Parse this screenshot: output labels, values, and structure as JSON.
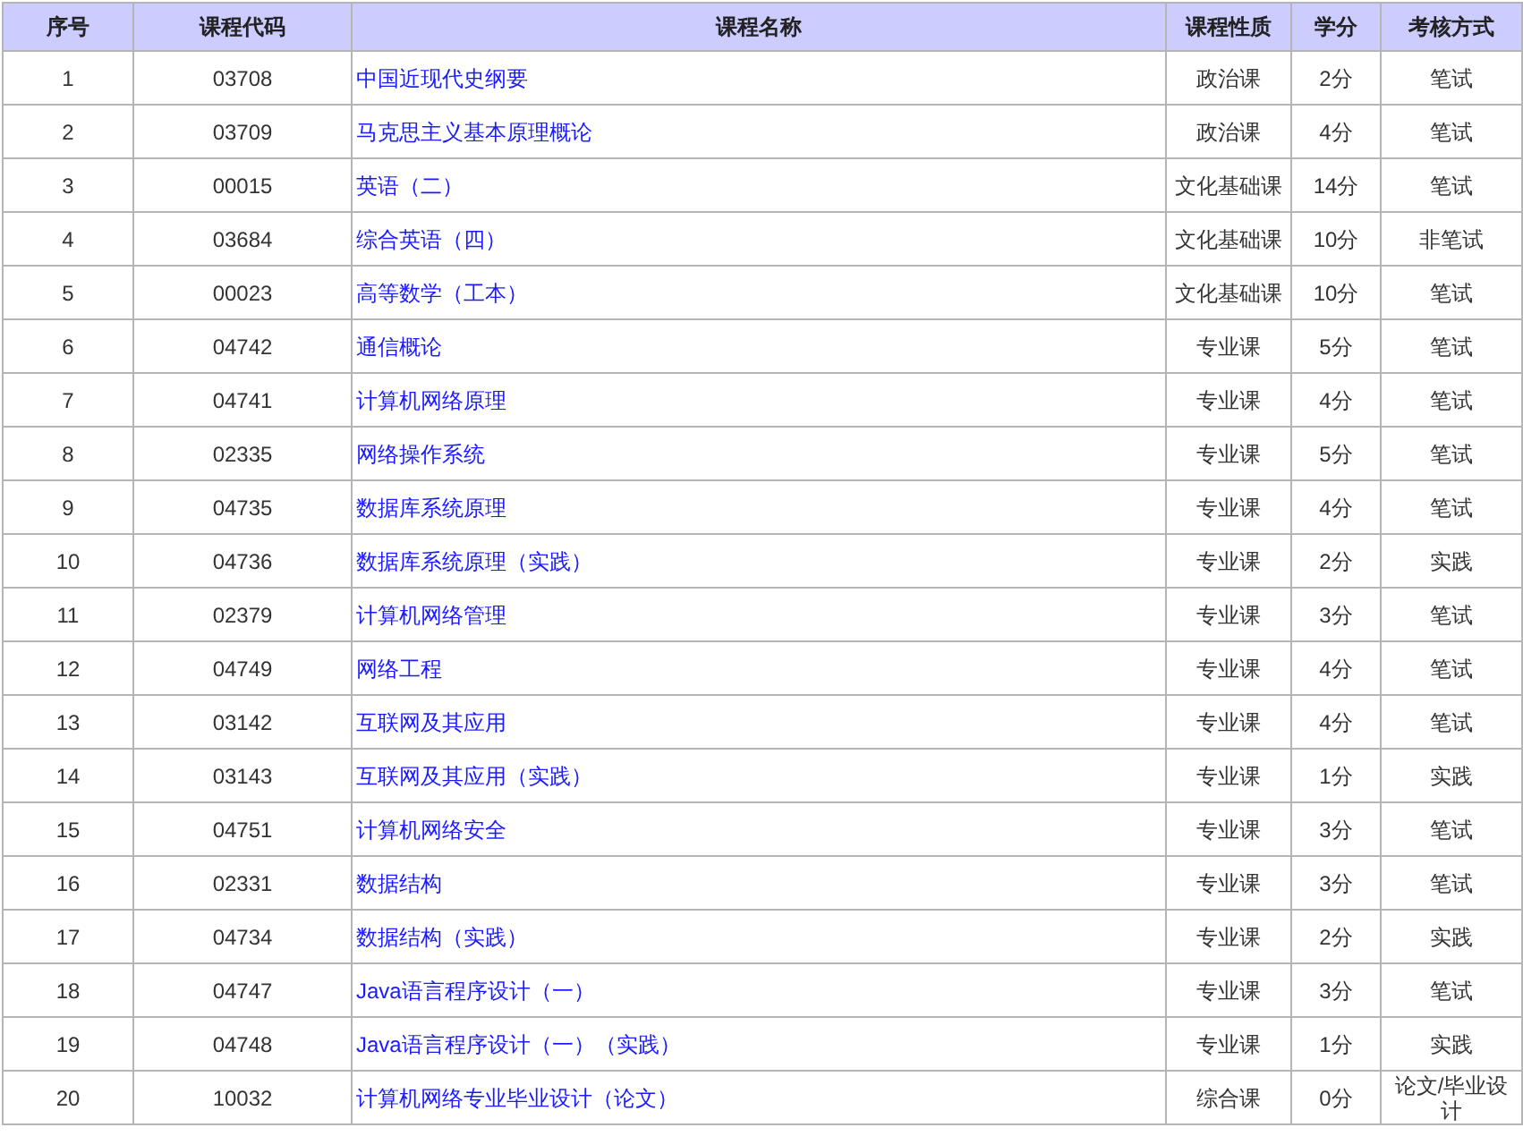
{
  "table": {
    "columns": [
      "序号",
      "课程代码",
      "课程名称",
      "课程性质",
      "学分",
      "考核方式"
    ],
    "rows": [
      {
        "index": "1",
        "code": "03708",
        "name": "中国近现代史纲要",
        "type": "政治课",
        "credits": "2分",
        "exam": "笔试"
      },
      {
        "index": "2",
        "code": "03709",
        "name": "马克思主义基本原理概论",
        "type": "政治课",
        "credits": "4分",
        "exam": "笔试"
      },
      {
        "index": "3",
        "code": "00015",
        "name": "英语（二）",
        "type": "文化基础课",
        "credits": "14分",
        "exam": "笔试"
      },
      {
        "index": "4",
        "code": "03684",
        "name": "综合英语（四）",
        "type": "文化基础课",
        "credits": "10分",
        "exam": "非笔试"
      },
      {
        "index": "5",
        "code": "00023",
        "name": "高等数学（工本）",
        "type": "文化基础课",
        "credits": "10分",
        "exam": "笔试"
      },
      {
        "index": "6",
        "code": "04742",
        "name": "通信概论",
        "type": "专业课",
        "credits": "5分",
        "exam": "笔试"
      },
      {
        "index": "7",
        "code": "04741",
        "name": "计算机网络原理",
        "type": "专业课",
        "credits": "4分",
        "exam": "笔试"
      },
      {
        "index": "8",
        "code": "02335",
        "name": "网络操作系统",
        "type": "专业课",
        "credits": "5分",
        "exam": "笔试"
      },
      {
        "index": "9",
        "code": "04735",
        "name": "数据库系统原理",
        "type": "专业课",
        "credits": "4分",
        "exam": "笔试"
      },
      {
        "index": "10",
        "code": "04736",
        "name": "数据库系统原理（实践）",
        "type": "专业课",
        "credits": "2分",
        "exam": "实践"
      },
      {
        "index": "11",
        "code": "02379",
        "name": "计算机网络管理",
        "type": "专业课",
        "credits": "3分",
        "exam": "笔试"
      },
      {
        "index": "12",
        "code": "04749",
        "name": "网络工程",
        "type": "专业课",
        "credits": "4分",
        "exam": "笔试"
      },
      {
        "index": "13",
        "code": "03142",
        "name": "互联网及其应用",
        "type": "专业课",
        "credits": "4分",
        "exam": "笔试"
      },
      {
        "index": "14",
        "code": "03143",
        "name": "互联网及其应用（实践）",
        "type": "专业课",
        "credits": "1分",
        "exam": "实践"
      },
      {
        "index": "15",
        "code": "04751",
        "name": "计算机网络安全",
        "type": "专业课",
        "credits": "3分",
        "exam": "笔试"
      },
      {
        "index": "16",
        "code": "02331",
        "name": "数据结构",
        "type": "专业课",
        "credits": "3分",
        "exam": "笔试"
      },
      {
        "index": "17",
        "code": "04734",
        "name": "数据结构（实践）",
        "type": "专业课",
        "credits": "2分",
        "exam": "实践"
      },
      {
        "index": "18",
        "code": "04747",
        "name": "Java语言程序设计（一）",
        "type": "专业课",
        "credits": "3分",
        "exam": "笔试"
      },
      {
        "index": "19",
        "code": "04748",
        "name": "Java语言程序设计（一）（实践）",
        "type": "专业课",
        "credits": "1分",
        "exam": "实践"
      },
      {
        "index": "20",
        "code": "10032",
        "name": "计算机网络专业毕业设计（论文）",
        "type": "综合课",
        "credits": "0分",
        "exam": "论文/毕业设计"
      }
    ]
  }
}
